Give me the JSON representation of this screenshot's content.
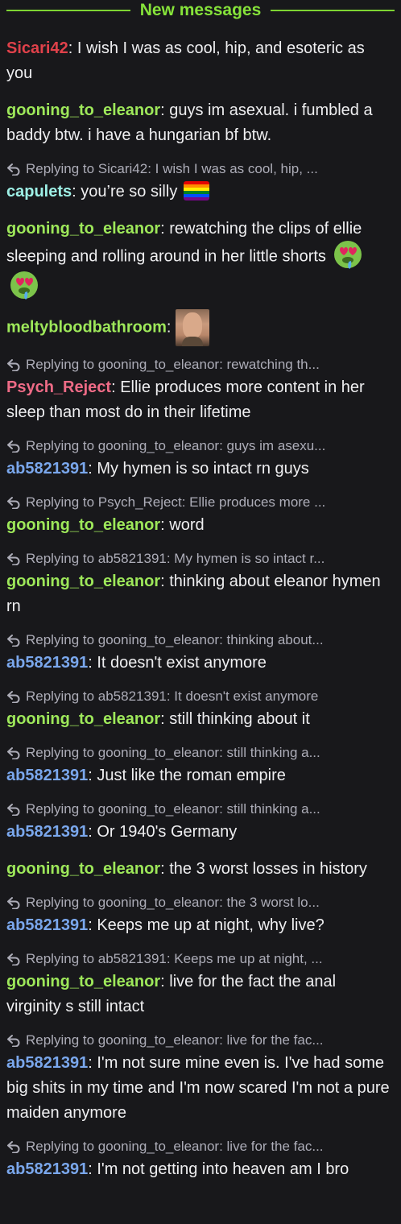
{
  "divider": {
    "label": "New messages",
    "color": "#86e33a"
  },
  "colors": {
    "red": "#e0414a",
    "green": "#9ee85a",
    "cyan": "#9ef0e6",
    "pink": "#ee6b86",
    "blue": "#7aa7ec",
    "reply_gray": "#adadb8",
    "background": "#18181b"
  },
  "messages": [
    {
      "user": "Sicari42",
      "color": "#e0414a",
      "text": "I wish I was as cool, hip, and esoteric as you"
    },
    {
      "user": "gooning_to_eleanor",
      "color": "#9ee85a",
      "text": "guys im asexual. i fumbled a baddy btw. i have a hungarian bf btw."
    },
    {
      "reply": "Replying to Sicari42: I wish I was as cool, hip, ...",
      "user": "capulets",
      "color": "#9ef0e6",
      "text": "you’re so silly",
      "emote": "pride-flag-emote"
    },
    {
      "user": "gooning_to_eleanor",
      "color": "#9ee85a",
      "text": "rewatching the clips of ellie sleeping and rolling around in her little shorts",
      "emote": "heart-eyes-drool-emote"
    },
    {
      "user": "meltybloodbathroom",
      "color": "#9ee85a",
      "text": "",
      "emote": "face-photo-emote"
    },
    {
      "reply": "Replying to gooning_to_eleanor: rewatching th...",
      "user": "Psych_Reject",
      "color": "#ee6b86",
      "text": "Ellie produces more content in her sleep than most do in their lifetime"
    },
    {
      "reply": "Replying to gooning_to_eleanor: guys im asexu...",
      "user": "ab5821391",
      "color": "#7aa7ec",
      "text": "My hymen is so intact rn guys"
    },
    {
      "reply": "Replying to Psych_Reject: Ellie produces more ...",
      "user": "gooning_to_eleanor",
      "color": "#9ee85a",
      "text": "word"
    },
    {
      "reply": "Replying to ab5821391: My hymen is so intact r...",
      "user": "gooning_to_eleanor",
      "color": "#9ee85a",
      "text": "thinking about eleanor hymen rn"
    },
    {
      "reply": "Replying to gooning_to_eleanor: thinking about...",
      "user": "ab5821391",
      "color": "#7aa7ec",
      "text": "It doesn't exist anymore"
    },
    {
      "reply": "Replying to ab5821391: It doesn't exist anymore",
      "user": "gooning_to_eleanor",
      "color": "#9ee85a",
      "text": "still thinking about it"
    },
    {
      "reply": "Replying to gooning_to_eleanor: still thinking a...",
      "user": "ab5821391",
      "color": "#7aa7ec",
      "text": "Just like the roman empire"
    },
    {
      "reply": "Replying to gooning_to_eleanor: still thinking a...",
      "user": "ab5821391",
      "color": "#7aa7ec",
      "text": "Or 1940's Germany"
    },
    {
      "user": "gooning_to_eleanor",
      "color": "#9ee85a",
      "text": "the 3 worst losses in history"
    },
    {
      "reply": "Replying to gooning_to_eleanor: the 3 worst lo...",
      "user": "ab5821391",
      "color": "#7aa7ec",
      "text": "Keeps me up at night, why live?"
    },
    {
      "reply": "Replying to ab5821391: Keeps me up at night, ...",
      "user": "gooning_to_eleanor",
      "color": "#9ee85a",
      "text": "live for the fact the anal virginity s still intact"
    },
    {
      "reply": "Replying to gooning_to_eleanor: live for the fac...",
      "user": "ab5821391",
      "color": "#7aa7ec",
      "text": "I'm not sure mine even is. I've had some big shits in my time and I'm now scared I'm not a pure maiden anymore"
    },
    {
      "reply": "Replying to gooning_to_eleanor: live for the fac...",
      "user": "ab5821391",
      "color": "#7aa7ec",
      "text": "I'm not getting into heaven am I bro"
    }
  ]
}
